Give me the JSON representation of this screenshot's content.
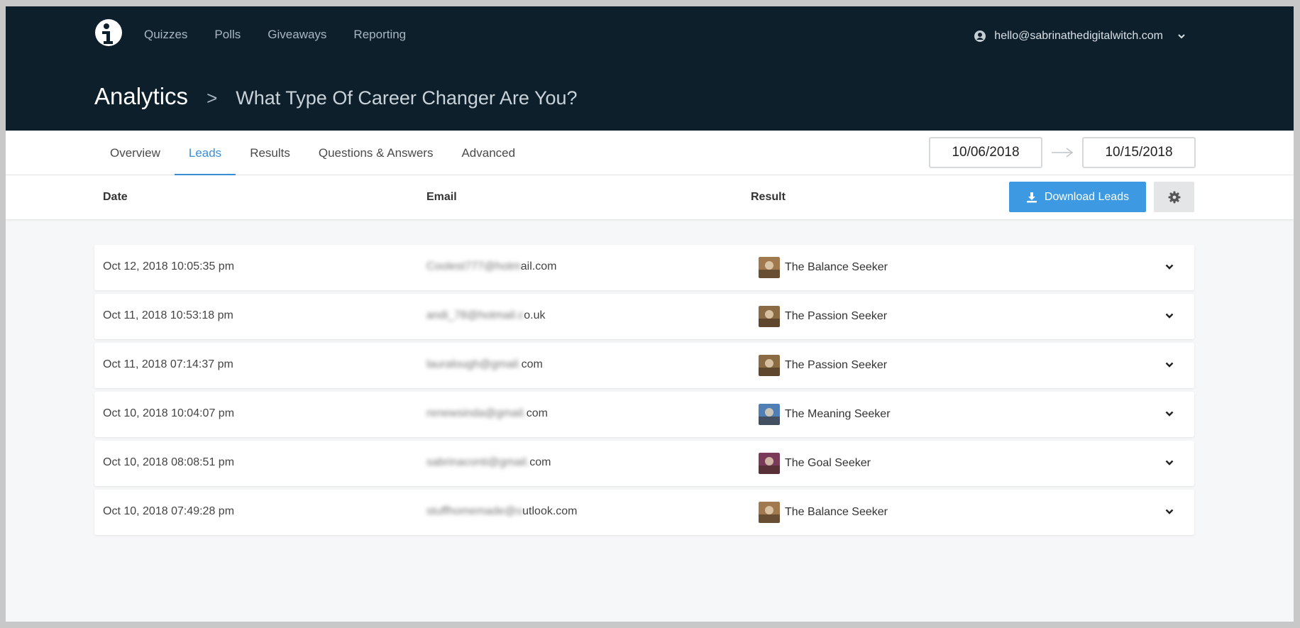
{
  "nav": {
    "items": [
      "Quizzes",
      "Polls",
      "Giveaways",
      "Reporting"
    ],
    "account_email": "hello@sabrinathedigitalwitch.com"
  },
  "breadcrumb": {
    "section": "Analytics",
    "separator": ">",
    "quiz_title": "What Type Of Career Changer Are You?"
  },
  "tabs": [
    "Overview",
    "Leads",
    "Results",
    "Questions & Answers",
    "Advanced"
  ],
  "active_tab": "Leads",
  "date_range": {
    "start": "10/06/2018",
    "end": "10/15/2018"
  },
  "table": {
    "headers": {
      "date": "Date",
      "email": "Email",
      "result": "Result"
    },
    "download_label": "Download Leads",
    "rows": [
      {
        "date": "Oct 12, 2018 10:05:35 pm",
        "email_hidden": "Coolest777@hotm",
        "email_visible": "ail.com",
        "result": "The Balance Seeker",
        "thumb_color": "#a07a4e"
      },
      {
        "date": "Oct 11, 2018 10:53:18 pm",
        "email_hidden": "andi_78@hotmail.c",
        "email_visible": "o.uk",
        "result": "The Passion Seeker",
        "thumb_color": "#8a6b43"
      },
      {
        "date": "Oct 11, 2018 07:14:37 pm",
        "email_hidden": "lauralough@gmail.",
        "email_visible": "com",
        "result": "The Passion Seeker",
        "thumb_color": "#8a6b43"
      },
      {
        "date": "Oct 10, 2018 10:04:07 pm",
        "email_hidden": "renewsinda@gmail.",
        "email_visible": "com",
        "result": "The Meaning Seeker",
        "thumb_color": "#4f7fb5"
      },
      {
        "date": "Oct 10, 2018 08:08:51 pm",
        "email_hidden": "sabrinaconti@gmail.",
        "email_visible": "com",
        "result": "The Goal Seeker",
        "thumb_color": "#7a3a5a"
      },
      {
        "date": "Oct 10, 2018 07:49:28 pm",
        "email_hidden": "stuffhomemade@o",
        "email_visible": "utlook.com",
        "result": "The Balance Seeker",
        "thumb_color": "#a07a4e"
      }
    ]
  },
  "colors": {
    "header_bg": "#0c1f2b",
    "accent": "#3a8fd9",
    "button": "#3d9ae2"
  },
  "icons": {
    "logo": "info-logo-icon",
    "user": "user-circle-icon",
    "dropdown": "chevron-down-icon",
    "arrow": "arrow-right-icon",
    "download": "download-icon",
    "settings": "gear-icon",
    "expand": "chevron-down-icon"
  }
}
